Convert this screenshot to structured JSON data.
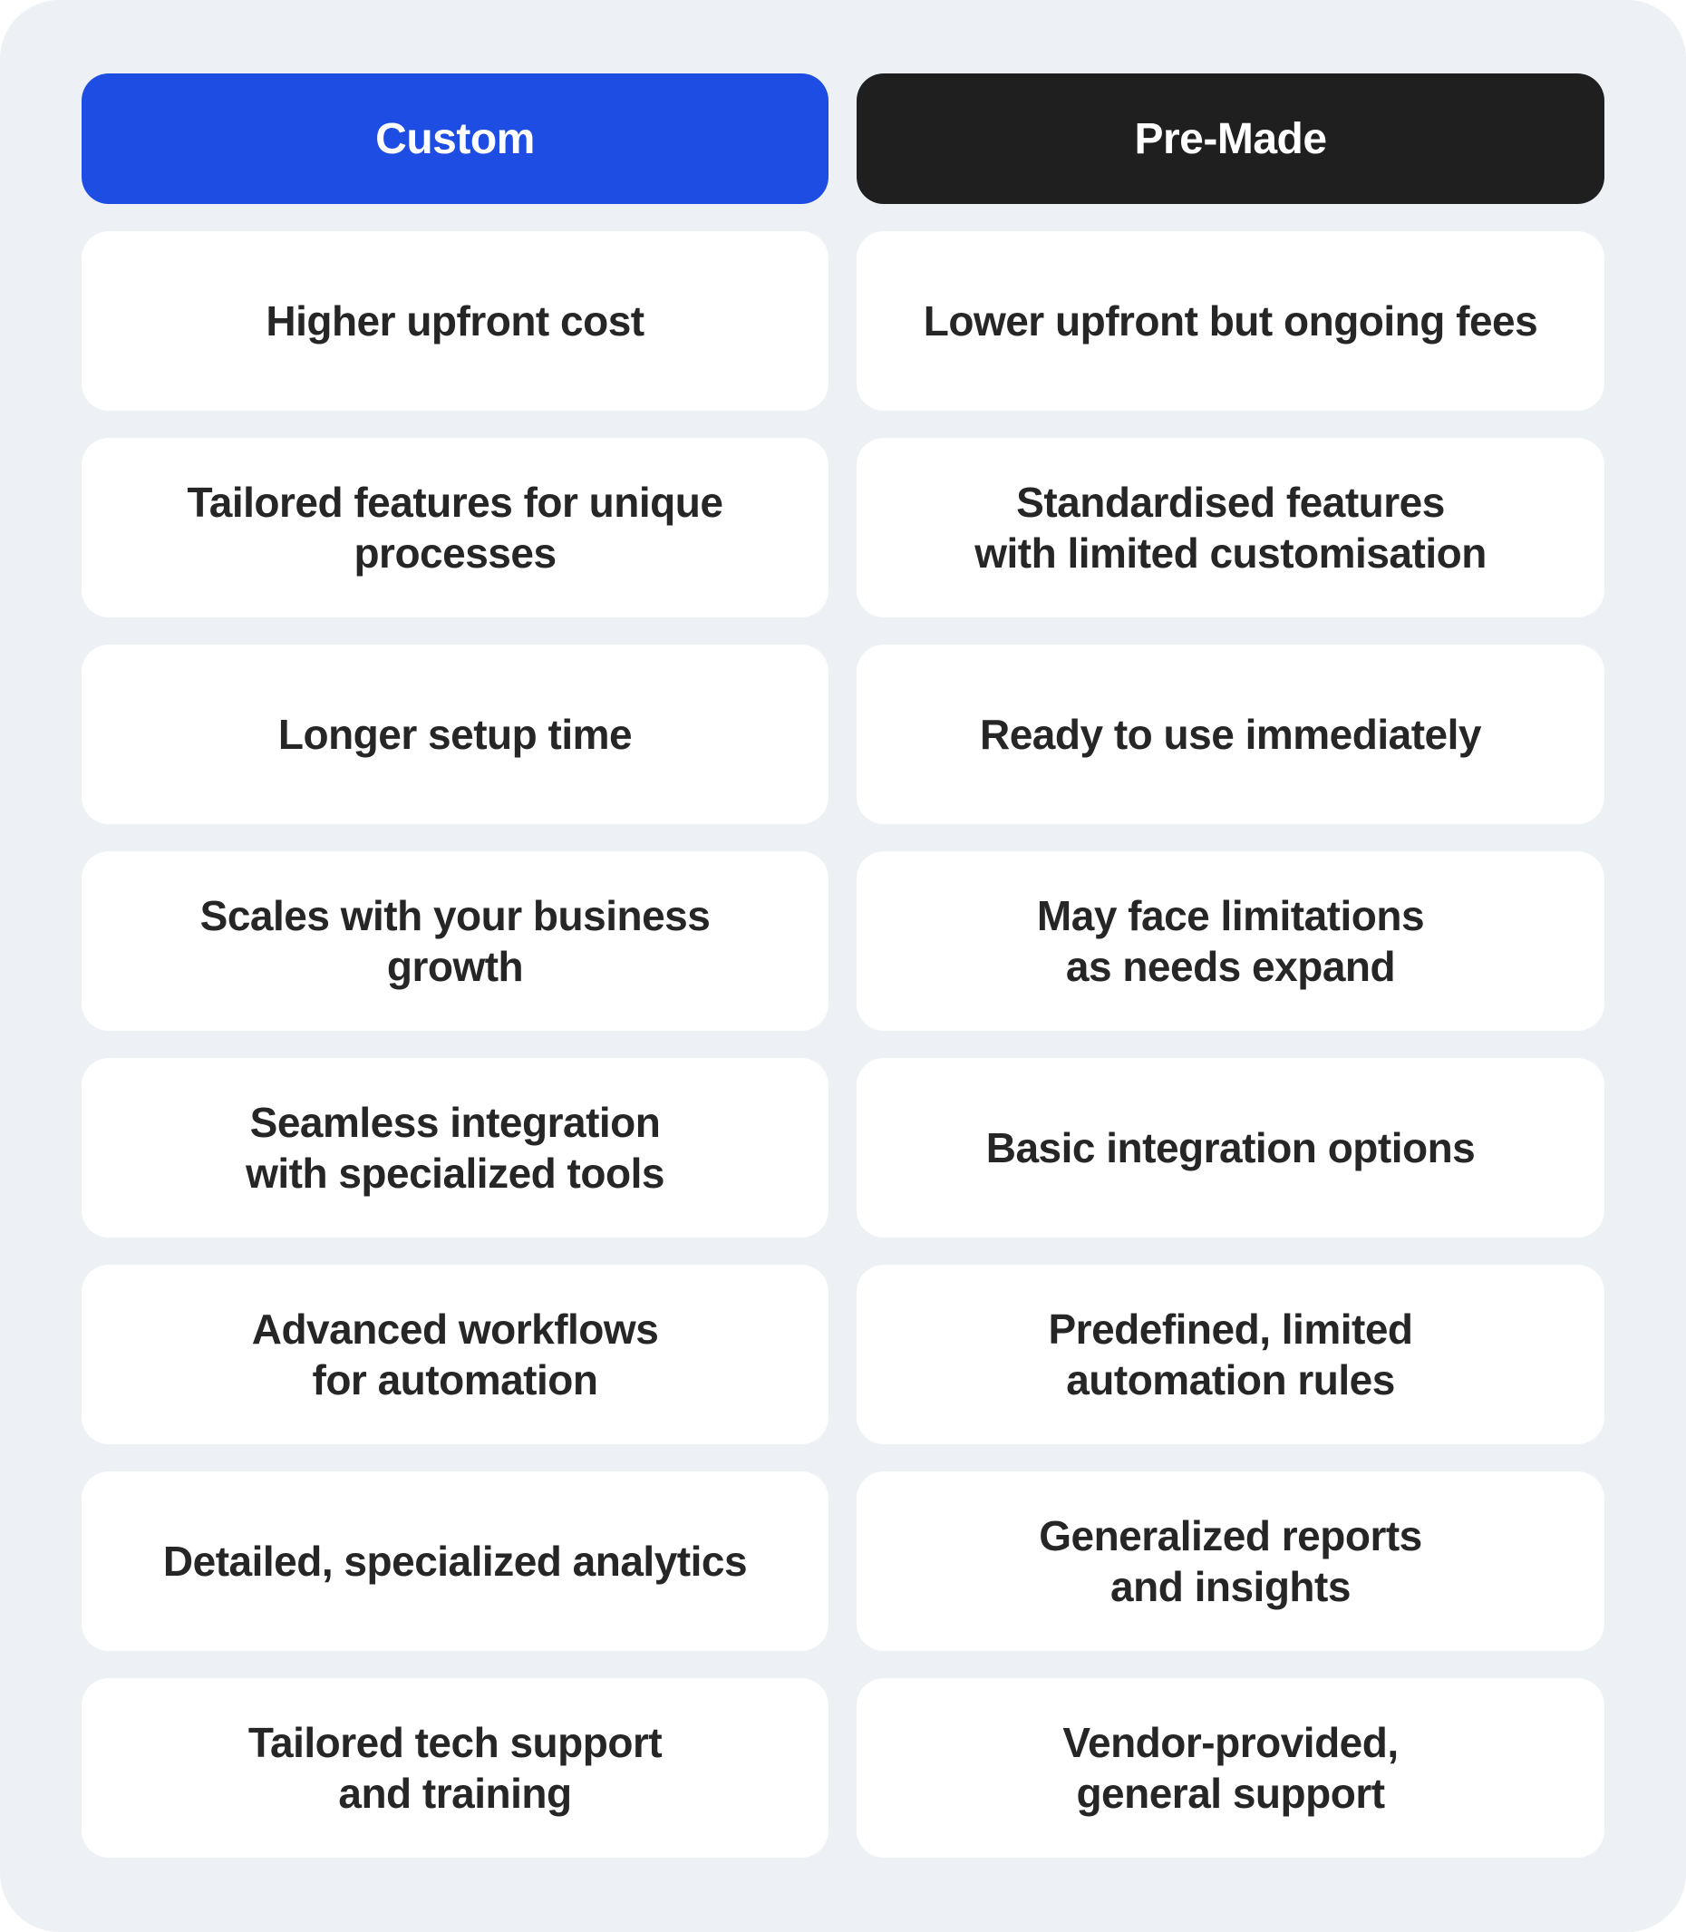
{
  "comparison": {
    "columns": [
      {
        "label": "Custom",
        "color": "#1e4de3"
      },
      {
        "label": "Pre-Made",
        "color": "#1f1f1f"
      }
    ],
    "rows": [
      {
        "custom": "Higher upfront cost",
        "premade": "Lower upfront but ongoing fees"
      },
      {
        "custom": "Tailored features for unique\nprocesses",
        "premade": "Standardised features\nwith limited customisation"
      },
      {
        "custom": "Longer setup time",
        "premade": "Ready to use immediately"
      },
      {
        "custom": "Scales with your business\ngrowth",
        "premade": "May face limitations\nas needs expand"
      },
      {
        "custom": "Seamless integration\nwith specialized tools",
        "premade": "Basic integration options"
      },
      {
        "custom": "Advanced workflows\nfor automation",
        "premade": "Predefined, limited\nautomation rules"
      },
      {
        "custom": "Detailed, specialized analytics",
        "premade": "Generalized reports\nand insights"
      },
      {
        "custom": "Tailored tech support\nand training",
        "premade": "Vendor-provided,\ngeneral support"
      }
    ]
  }
}
